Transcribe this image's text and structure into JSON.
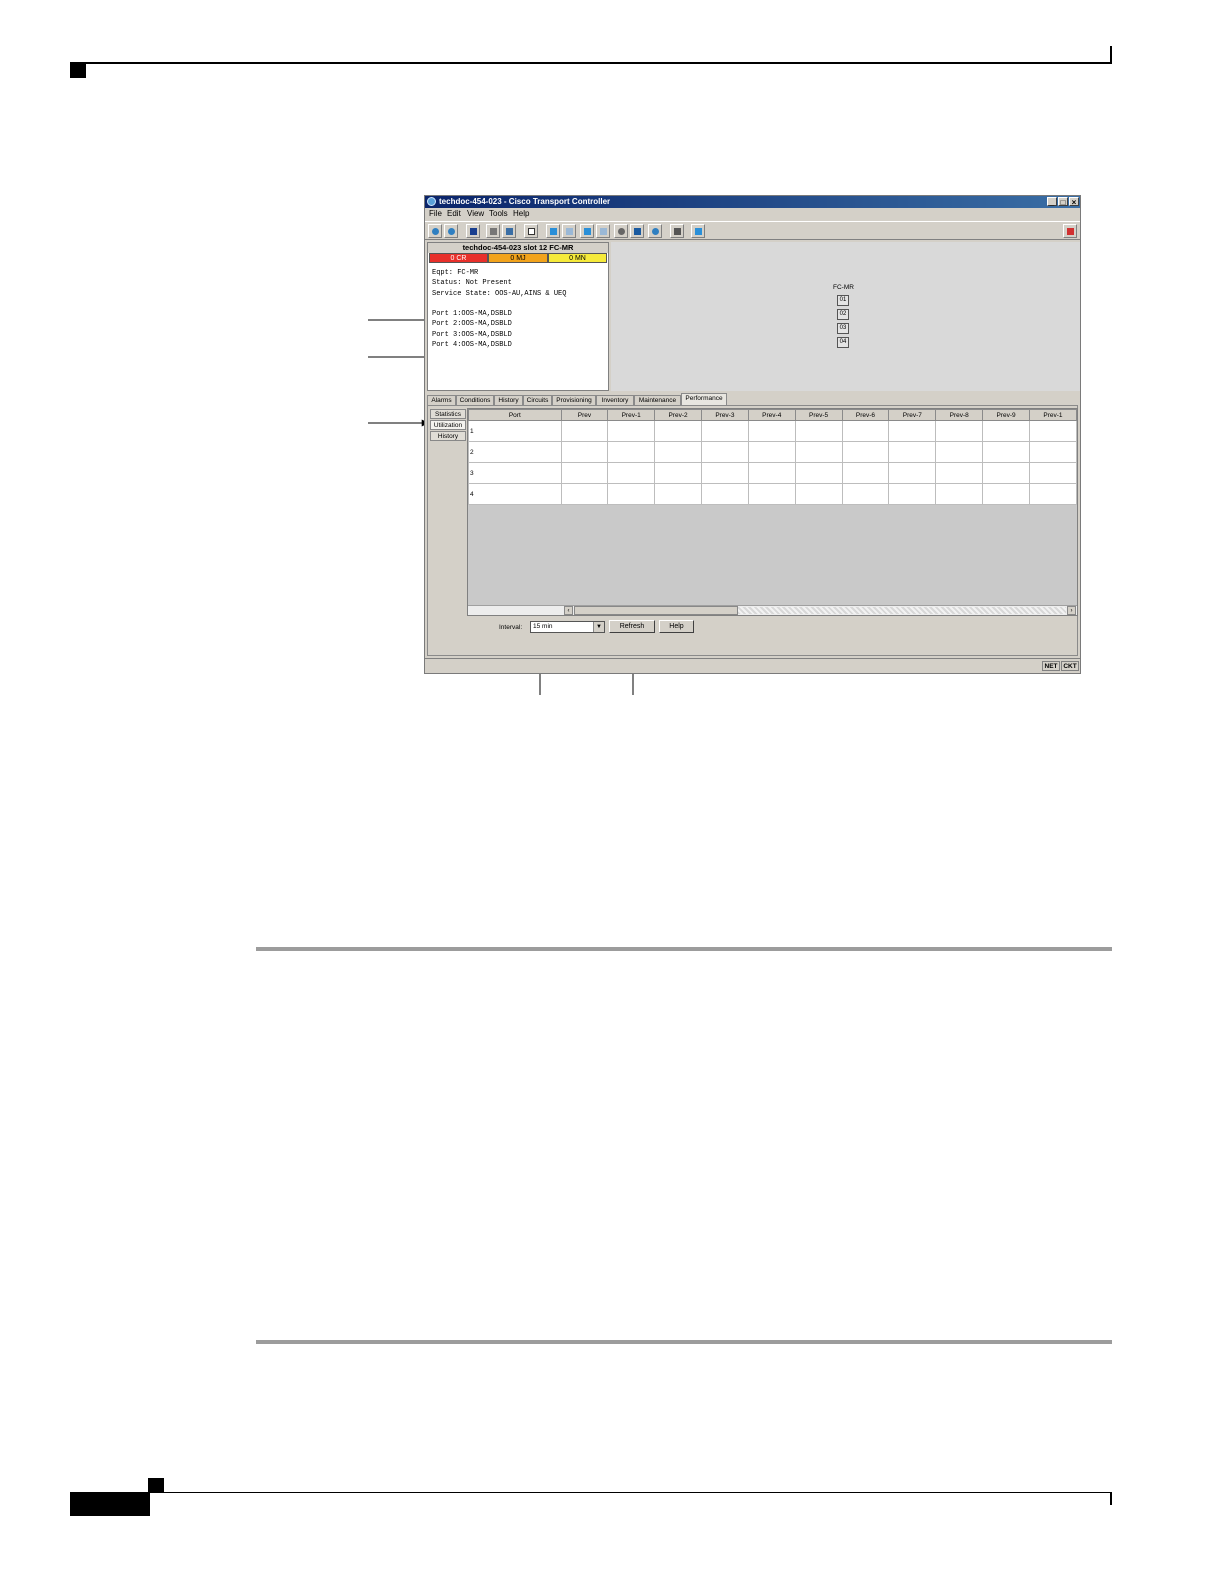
{
  "window": {
    "title": "techdoc-454-023 - Cisco Transport Controller",
    "controls": [
      "_",
      "□",
      "×"
    ]
  },
  "menu": [
    "File",
    "Edit",
    "View",
    "Tools",
    "Help"
  ],
  "toolbar_icons": [
    "globe-icon",
    "globe-icon",
    "lock-icon",
    "print-icon",
    "export-icon",
    "copy-icon",
    "back-arrow-icon",
    "forward-arrow-icon",
    "up-arrow-icon",
    "down-arrow-icon",
    "gear-icon",
    "network-icon",
    "globe-icon",
    "printer-icon",
    "chart-icon",
    "delete-icon"
  ],
  "node_panel": {
    "title": "techdoc-454-023 slot 12 FC-MR",
    "alarms": {
      "critical": "0 CR",
      "major": "0 MJ",
      "minor": "0 MN"
    },
    "lines": [
      "Eqpt: FC-MR",
      "Status: Not Present",
      "Service State: OOS-AU,AINS & UEQ",
      "",
      "Port 1:OOS-MA,DSBLD",
      "Port 2:OOS-MA,DSBLD",
      "Port 3:OOS-MA,DSBLD",
      "Port 4:OOS-MA,DSBLD"
    ]
  },
  "card_view": {
    "card_label": "FC-MR",
    "ports": [
      "01",
      "02",
      "03",
      "04"
    ]
  },
  "tabs": [
    "Alarms",
    "Conditions",
    "History",
    "Circuits",
    "Provisioning",
    "Inventory",
    "Maintenance",
    "Performance"
  ],
  "active_tab": "Performance",
  "subtabs": [
    "Statistics",
    "Utilization",
    "History"
  ],
  "active_subtab": "Utilization",
  "table": {
    "columns": [
      "Port",
      "Prev",
      "Prev-1",
      "Prev-2",
      "Prev-3",
      "Prev-4",
      "Prev-5",
      "Prev-6",
      "Prev-7",
      "Prev-8",
      "Prev-9",
      "Prev-1"
    ],
    "rows": [
      "1",
      "2",
      "3",
      "4"
    ]
  },
  "interval": {
    "label": "Interval:",
    "value": "15 min"
  },
  "buttons": {
    "refresh": "Refresh",
    "help": "Help"
  },
  "status_indicators": [
    "NET",
    "CKT"
  ],
  "colors": {
    "critical": "#e8302a",
    "major": "#f2a31b",
    "minor": "#f6ea3a",
    "titlebar": "#0a246a"
  }
}
